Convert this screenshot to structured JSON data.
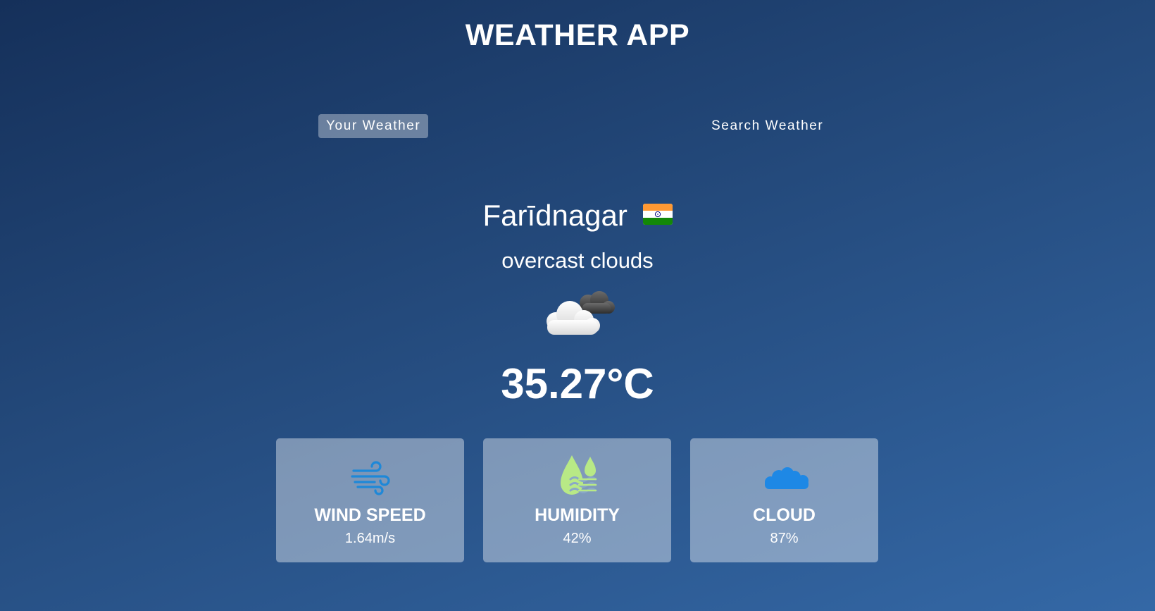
{
  "app": {
    "title": "WEATHER APP"
  },
  "tabs": [
    {
      "label": "Your Weather",
      "active": true
    },
    {
      "label": "Search Weather",
      "active": false
    }
  ],
  "weather": {
    "city": "Farīdnagar",
    "country_flag_icon": "india-flag-icon",
    "description": "overcast clouds",
    "condition_icon": "overcast-clouds-icon",
    "temperature": "35.27°C"
  },
  "stats": [
    {
      "label": "WIND SPEED",
      "value": "1.64m/s",
      "icon": "wind-icon",
      "icon_color": "#1e88d8"
    },
    {
      "label": "HUMIDITY",
      "value": "42%",
      "icon": "humidity-icon",
      "icon_color": "#b8e986"
    },
    {
      "label": "CLOUD",
      "value": "87%",
      "icon": "cloud-icon",
      "icon_color": "#1e88e5"
    }
  ],
  "colors": {
    "background_top": "#15305a",
    "background_bottom": "#3468a6",
    "active_tab_bg": "rgba(255,255,255,0.35)",
    "card_bg": "rgba(255,255,255,0.4)"
  }
}
